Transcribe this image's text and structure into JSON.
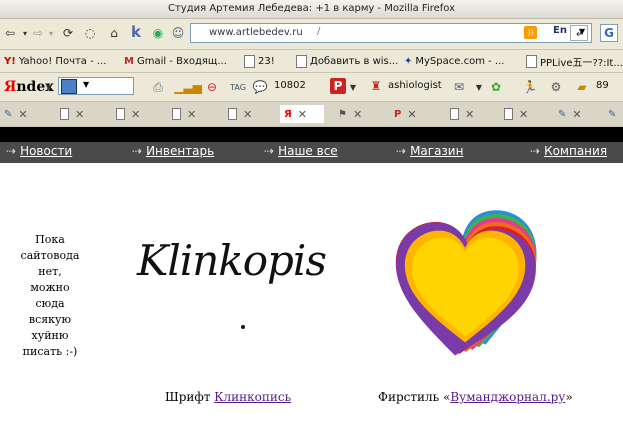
{
  "window": {
    "title": "Студия Артемия Лебедева: +1 в карму - Mozilla Firefox"
  },
  "urlbar": {
    "url": "www.artlebedev.ru",
    "path": "/",
    "lang": "En"
  },
  "bookmarks": [
    {
      "label": "Yahoo! Почта - ..."
    },
    {
      "label": "Gmail - Входящ..."
    },
    {
      "label": "23!"
    },
    {
      "label": "Добавить в wis..."
    },
    {
      "label": "MySpace.com - ..."
    },
    {
      "label": "PPLive五一??:It..."
    }
  ],
  "yandex": {
    "logo_first": "Я",
    "logo_rest": "ndex",
    "counter": "10802",
    "user": "ashiologist",
    "mail_count": "89"
  },
  "menu": [
    {
      "label": "Новости"
    },
    {
      "label": "Инвентарь"
    },
    {
      "label": "Наше все"
    },
    {
      "label": "Магазин"
    },
    {
      "label": "Компания"
    }
  ],
  "content": {
    "note_lines": [
      "Пока",
      "сайтовода",
      "нет,",
      "можно",
      "сюда",
      "всякую",
      "хуйню",
      "писать :-)"
    ],
    "logo_text": "Klinkopis",
    "font_caption_prefix": "Шрифт ",
    "font_link": "Клинкопись",
    "style_caption_prefix": "Фирстиль «",
    "style_link": "Вуманджорнал.ру",
    "style_caption_suffix": "»"
  }
}
